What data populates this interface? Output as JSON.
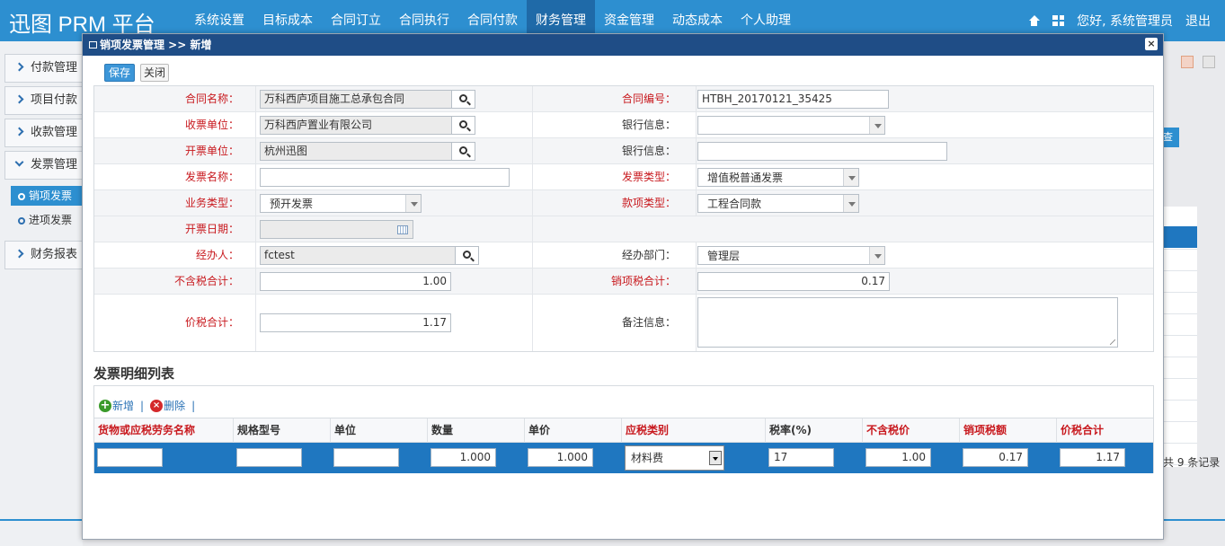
{
  "app": {
    "title": "迅图 PRM 平台"
  },
  "nav": {
    "items": [
      "系统设置",
      "目标成本",
      "合同订立",
      "合同执行",
      "合同付款",
      "财务管理",
      "资金管理",
      "动态成本",
      "个人助理"
    ],
    "active_index": 5
  },
  "header_right": {
    "greeting": "您好, 系统管理员",
    "logout": "退出"
  },
  "sidebar": {
    "items": [
      {
        "label": "付款管理"
      },
      {
        "label": "项目付款"
      },
      {
        "label": "收款管理"
      },
      {
        "label": "发票管理"
      },
      {
        "label": "财务报表"
      }
    ],
    "sub_items": [
      {
        "label": "销项发票",
        "active": true
      },
      {
        "label": "进项发票",
        "active": false
      }
    ]
  },
  "background": {
    "query_btn": "查询",
    "records": "共 9 条记录"
  },
  "modal": {
    "title": "销项发票管理 >> 新增",
    "save": "保存",
    "close": "关闭",
    "form": {
      "contract_name": {
        "label": "合同名称：",
        "value": "万科西庐项目施工总承包合同"
      },
      "contract_no": {
        "label": "合同编号：",
        "value": "HTBH_20170121_35425"
      },
      "payee": {
        "label": "收票单位：",
        "value": "万科西庐置业有限公司"
      },
      "bank_info_1": {
        "label": "银行信息：",
        "value": ""
      },
      "issuer": {
        "label": "开票单位：",
        "value": "杭州迅图"
      },
      "bank_info_2": {
        "label": "银行信息：",
        "value": ""
      },
      "invoice_name": {
        "label": "发票名称：",
        "value": ""
      },
      "invoice_type": {
        "label": "发票类型：",
        "value": "增值税普通发票"
      },
      "business_type": {
        "label": "业务类型：",
        "value": "预开发票"
      },
      "payment_type": {
        "label": "款项类型：",
        "value": "工程合同款"
      },
      "issue_date": {
        "label": "开票日期：",
        "value": ""
      },
      "handler": {
        "label": "经办人：",
        "value": "fctest"
      },
      "department": {
        "label": "经办部门：",
        "value": "管理层"
      },
      "pre_tax_total": {
        "label": "不含税合计：",
        "value": "1.00"
      },
      "output_tax_total": {
        "label": "销项税合计：",
        "value": "0.17"
      },
      "tax_incl_total": {
        "label": "价税合计：",
        "value": "1.17"
      },
      "remarks": {
        "label": "备注信息：",
        "value": ""
      }
    },
    "detail": {
      "title": "发票明细列表",
      "add": "新增",
      "delete": "删除",
      "columns": [
        {
          "label": "货物或应税劳务名称",
          "required": true
        },
        {
          "label": "规格型号",
          "required": false
        },
        {
          "label": "单位",
          "required": false
        },
        {
          "label": "数量",
          "required": false
        },
        {
          "label": "单价",
          "required": false
        },
        {
          "label": "应税类别",
          "required": true
        },
        {
          "label": "税率(%)",
          "required": false
        },
        {
          "label": "不含税价",
          "required": true
        },
        {
          "label": "销项税额",
          "required": true
        },
        {
          "label": "价税合计",
          "required": true
        }
      ],
      "row": {
        "goods_name": "",
        "spec": "",
        "unit": "",
        "quantity": "1.000",
        "unit_price": "1.000",
        "tax_category": "材料费",
        "tax_rate": "17",
        "pre_tax_price": "1.00",
        "output_tax": "0.17",
        "tax_incl_total": "1.17"
      }
    }
  },
  "colors": {
    "topbar": "#2d8fd0",
    "modal_header": "#1f4d86",
    "selected_row": "#1f77c0",
    "required_label": "#c8191e"
  }
}
